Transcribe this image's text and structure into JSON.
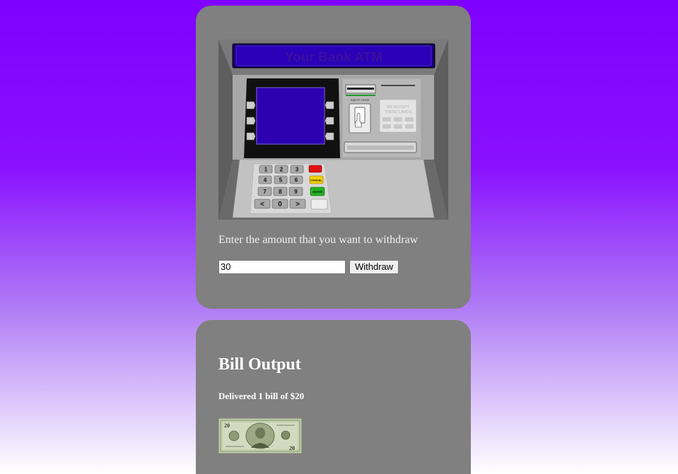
{
  "atm": {
    "bank_name": "Your Bank ATM",
    "card_slot_label": "INSERT HERE",
    "accepted_cards_label_1": "WE ACCEPT",
    "accepted_cards_label_2": "THESE CARDS",
    "keypad": {
      "keys": [
        "1",
        "2",
        "3",
        "4",
        "5",
        "6",
        "7",
        "8",
        "9",
        "<",
        "0",
        ">"
      ],
      "cancel_label": "CANCEL",
      "enter_label": "ENTER"
    }
  },
  "withdraw_form": {
    "prompt": "Enter the amount that you want to withdraw",
    "amount_value": "30",
    "button_label": "Withdraw"
  },
  "output": {
    "title": "Bill Output",
    "message": "Delivered 1 bill of $20",
    "bill_denomination": "20"
  },
  "colors": {
    "background_top": "#7f00ff",
    "background_bottom": "#ffffff",
    "panel": "#808080",
    "atm_screen": "#2d00b0",
    "bill_green": "#b9c9a0"
  }
}
